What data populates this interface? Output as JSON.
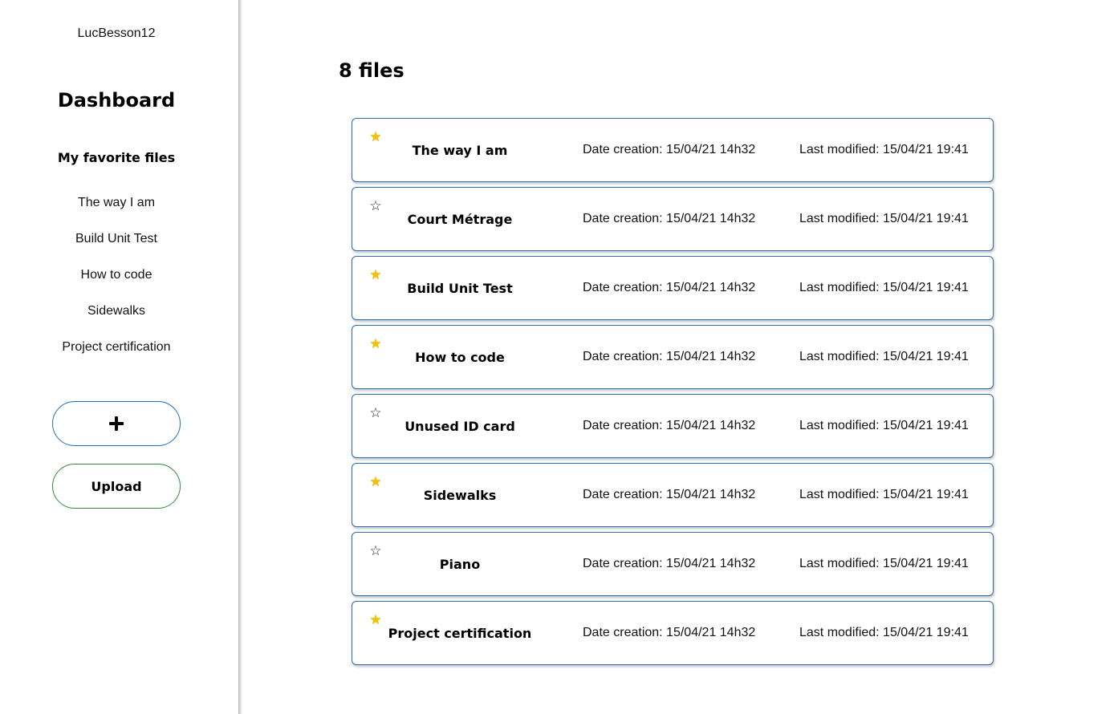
{
  "sidebar": {
    "username": "LucBesson12",
    "title": "Dashboard",
    "favorites_heading": "My favorite files",
    "favorites": [
      "The way I am",
      "Build Unit Test",
      "How to code",
      "Sidewalks",
      "Project certification"
    ],
    "add_icon": "plus-icon",
    "upload_label": "Upload"
  },
  "main": {
    "files_count": "8 files",
    "files": [
      {
        "name": "The way I am",
        "favorite": true,
        "created": "Date creation: 15/04/21 14h32",
        "modified": "Last modified: 15/04/21 19:41"
      },
      {
        "name": "Court Métrage",
        "favorite": false,
        "created": "Date creation: 15/04/21 14h32",
        "modified": "Last modified: 15/04/21 19:41"
      },
      {
        "name": "Build Unit Test",
        "favorite": true,
        "created": "Date creation: 15/04/21 14h32",
        "modified": "Last modified: 15/04/21 19:41"
      },
      {
        "name": "How to code",
        "favorite": true,
        "created": "Date creation: 15/04/21 14h32",
        "modified": "Last modified: 15/04/21 19:41"
      },
      {
        "name": "Unused ID card",
        "favorite": false,
        "created": "Date creation: 15/04/21 14h32",
        "modified": "Last modified: 15/04/21 19:41"
      },
      {
        "name": "Sidewalks",
        "favorite": true,
        "created": "Date creation: 15/04/21 14h32",
        "modified": "Last modified: 15/04/21 19:41"
      },
      {
        "name": "Piano",
        "favorite": false,
        "created": "Date creation: 15/04/21 14h32",
        "modified": "Last modified: 15/04/21 19:41"
      },
      {
        "name": "Project certification",
        "favorite": true,
        "created": "Date creation: 15/04/21 14h32",
        "modified": "Last modified: 15/04/21 19:41"
      }
    ]
  },
  "colors": {
    "row_border": "#2a6db5",
    "add_button_border": "#1f6fb5",
    "upload_button_border": "#2e8b3a",
    "star_favorite": "#f2c200",
    "star_default": "#222222"
  }
}
